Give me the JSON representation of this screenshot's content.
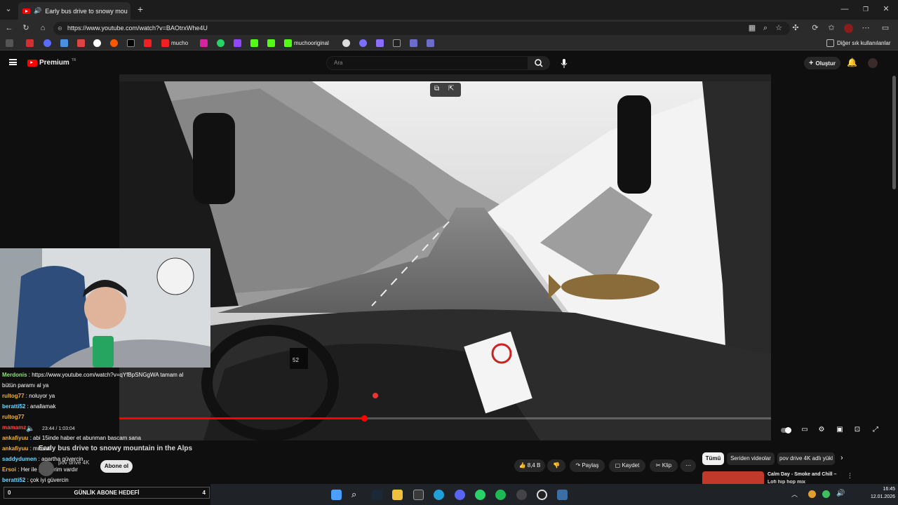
{
  "browser": {
    "tab_title": "Early bus drive to snowy mou",
    "url": "https://www.youtube.com/watch?v=BAOtrxWhe4U",
    "bookmarks": [
      "mucho",
      "muchooriginal"
    ],
    "other_bookmarks": "Diğer sık kullanılanlar"
  },
  "youtube": {
    "logo": "Premium",
    "logo_sup": "TR",
    "search_placeholder": "Ara",
    "create_label": "Oluştur"
  },
  "player": {
    "time": "23:44 / 1:03:04",
    "progress": 0.376,
    "speed_display": "52"
  },
  "video": {
    "title": "Early bus drive to snowy mountain in the Alps",
    "channel": "pov drive 4K",
    "subscribe_label": "Abone ol",
    "likes": "8,4 B",
    "share_label": "Paylaş",
    "save_label": "Kaydet",
    "clip_label": "Klip"
  },
  "chips": [
    "Tümü",
    "Seriden videolar",
    "pov drive 4K adlı yükl"
  ],
  "recommendation": {
    "title": "Calm Day - Smoke and Chill –",
    "subtitle": "Lofi hip hop mix"
  },
  "chat": [
    {
      "user": "Merdonis",
      "user_color": "#8fe27a",
      "text": "https://www.youtube.com/watch?v=qYfBpSNGgWA tamam al"
    },
    {
      "user": "",
      "user_color": "#ffffff",
      "text": "bütün paramı al ya"
    },
    {
      "user": "rultog77",
      "user_color": "#f0b232",
      "text": "noluyor ya"
    },
    {
      "user": "beratti52",
      "user_color": "#6fd6ff",
      "text": "anallamak"
    },
    {
      "user": "rultog77",
      "user_color": "#f0b232",
      "text": ""
    },
    {
      "user": "mamamz",
      "user_color": "#ff4a4a",
      "text": ""
    },
    {
      "user": "ankafiyuu",
      "user_color": "#f0b232",
      "text": "abi 15inde haber et abunman bascam sana"
    },
    {
      "user": "ankafiyuu",
      "user_color": "#f0b232",
      "text": "mms al"
    },
    {
      "user": "saddydumen",
      "user_color": "#6fd6ff",
      "text": "agartha güvercin"
    },
    {
      "user": "Ersoi",
      "user_color": "#f0b232",
      "text": "Her ile gönderim vardır"
    },
    {
      "user": "beratti52",
      "user_color": "#6fd6ff",
      "text": "çok iyi güvercin"
    }
  ],
  "goal": {
    "label": "GÜNLİK ABONE HEDEFİ",
    "left": "0",
    "right": "4"
  },
  "sticker": {
    "text": "IS ST EKTENIZ BOLUMESI SUN ICIR"
  },
  "taskbar": {
    "time": "16:45",
    "date": "12.01.2026"
  }
}
